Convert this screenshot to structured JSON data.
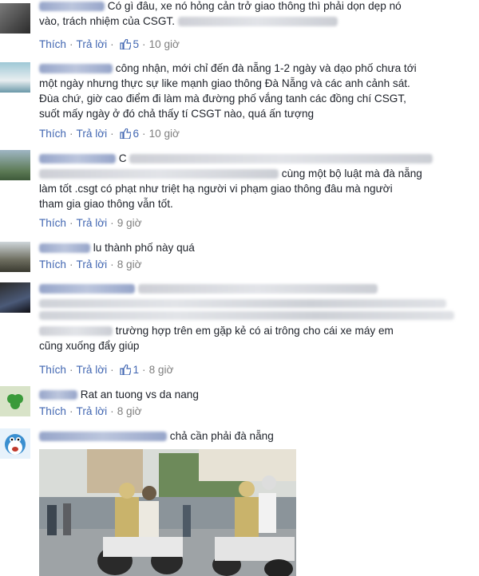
{
  "actions": {
    "like": "Thích",
    "reply": "Trả lời",
    "dot": "·"
  },
  "comments": [
    {
      "line1": "Có gì đâu, xe nó hỏng cản trở giao thông thì phải dọn dẹp nó",
      "line2": "vào, trách nhiệm của CSGT.",
      "likes": "5",
      "time": "10 giờ"
    },
    {
      "line1": "công nhận, mới chỉ đến đà nẵng 1-2 ngày và dạo phố chưa tới",
      "line2": "một ngày nhưng thực sự like mạnh giao thông Đà Nẵng và các anh cảnh sát.",
      "line3": "Đùa chứ, giờ cao điểm đi làm mà đường phố vắng tanh các đồng chí CSGT,",
      "line4": "suốt mấy ngày ở đó chả thấy tí CSGT nào, quá ấn tượng",
      "likes": "6",
      "time": "10 giờ"
    },
    {
      "line1": "C",
      "line2": "cùng một bộ luật mà đà nẵng",
      "line3": "làm tốt .csgt có phạt như triệt hạ người vi phạm giao thông đâu mà người",
      "line4": "tham gia giao thông vẫn tốt.",
      "time": "9 giờ"
    },
    {
      "line1": "lu thành phố này quá",
      "time": "8 giờ"
    },
    {
      "line1": "trường hợp trên em gặp kẻ có ai trông cho cái xe máy em",
      "line2": "cũng xuống đẩy giúp",
      "likes": "1",
      "time": "8 giờ"
    },
    {
      "line1": "Rat an tuong vs da nang",
      "time": "8 giờ"
    },
    {
      "line1": "chả cần phải đà nẵng"
    }
  ],
  "colors": {
    "link_blue": "#4267b2",
    "meta_gray": "#7f7f7f",
    "text": "#1d2129"
  }
}
